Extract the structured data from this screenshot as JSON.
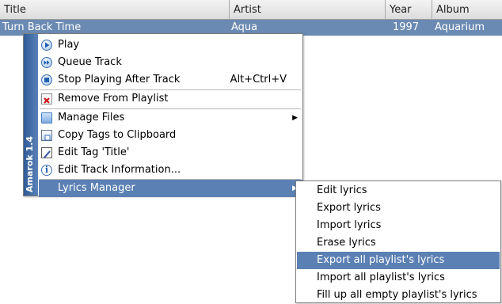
{
  "playlist": {
    "columns": [
      "Title",
      "Artist",
      "Year",
      "Album"
    ],
    "selected_row": {
      "title": "Turn Back Time",
      "artist": "Aqua",
      "year": "1997",
      "album": "Aquarium"
    }
  },
  "context_menu": {
    "sidebar_title": "Amarok 1.4",
    "items": [
      {
        "label": "Play",
        "icon": "play-icon"
      },
      {
        "label": "Queue Track",
        "icon": "queue-icon"
      },
      {
        "label": "Stop Playing After Track",
        "shortcut": "Alt+Ctrl+V",
        "icon": "stop-icon"
      },
      {
        "label": "Remove From Playlist",
        "icon": "remove-icon"
      },
      {
        "label": "Manage Files",
        "icon": "folder-icon"
      },
      {
        "label": "Copy Tags to Clipboard",
        "icon": "copy-icon"
      },
      {
        "label": "Edit Tag 'Title'",
        "icon": "edit-icon"
      },
      {
        "label": "Edit Track Information...",
        "icon": "info-icon"
      },
      {
        "label": "Lyrics Manager"
      }
    ]
  },
  "lyrics_submenu": {
    "items": [
      {
        "label": "Edit lyrics"
      },
      {
        "label": "Export lyrics"
      },
      {
        "label": "Import lyrics"
      },
      {
        "label": "Erase lyrics"
      },
      {
        "label": "Export all playlist's lyrics"
      },
      {
        "label": "Import all playlist's lyrics"
      },
      {
        "label": "Fill up all empty playlist's lyrics"
      }
    ],
    "highlighted_item": "Export all playlist's lyrics"
  },
  "colors": {
    "selection": "#6b8ab3",
    "menu_highlight": "#5b80b4",
    "sidebar": "#2f5b96"
  }
}
